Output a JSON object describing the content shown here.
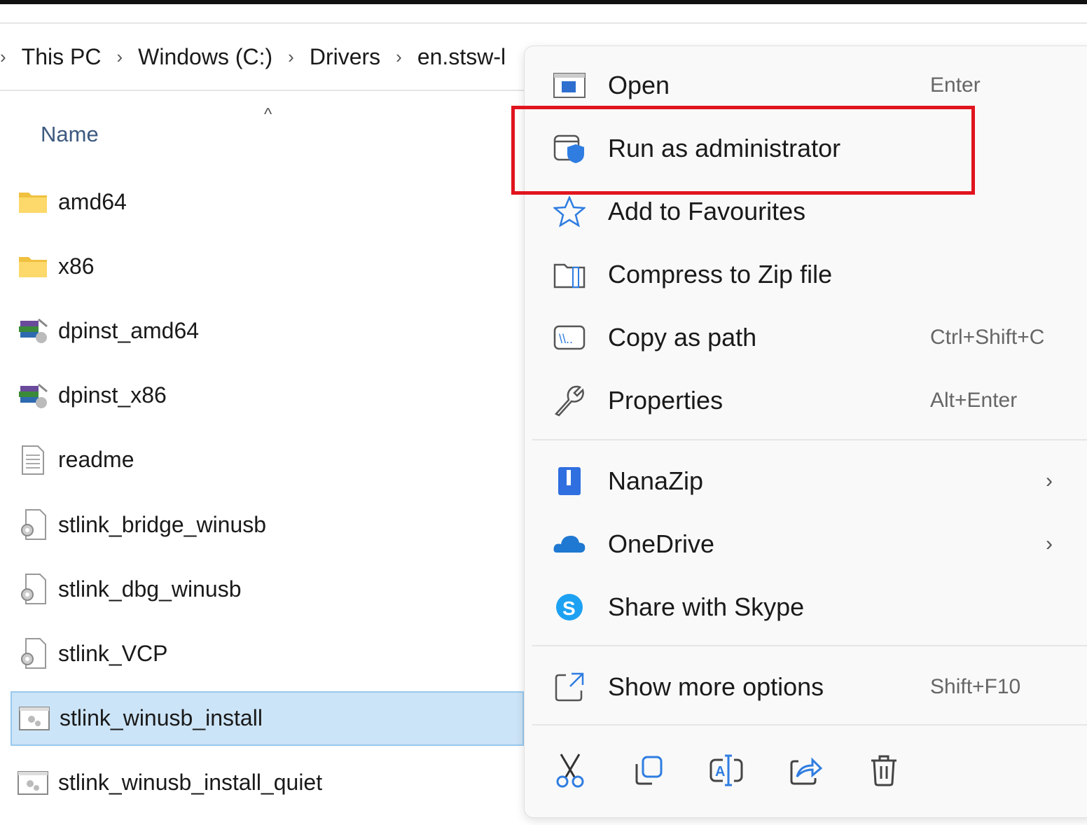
{
  "breadcrumb": [
    "This PC",
    "Windows (C:)",
    "Drivers",
    "en.stsw-l"
  ],
  "column_header": "Name",
  "files": [
    {
      "name": "amd64",
      "icon": "folder-icon"
    },
    {
      "name": "x86",
      "icon": "folder-icon"
    },
    {
      "name": "dpinst_amd64",
      "icon": "installer-icon"
    },
    {
      "name": "dpinst_x86",
      "icon": "installer-icon"
    },
    {
      "name": "readme",
      "icon": "text-file-icon"
    },
    {
      "name": "stlink_bridge_winusb",
      "icon": "settings-file-icon"
    },
    {
      "name": "stlink_dbg_winusb",
      "icon": "settings-file-icon"
    },
    {
      "name": "stlink_VCP",
      "icon": "settings-file-icon"
    },
    {
      "name": "stlink_winusb_install",
      "icon": "batch-file-icon",
      "selected": true
    },
    {
      "name": "stlink_winusb_install_quiet",
      "icon": "batch-file-icon"
    }
  ],
  "context_menu": {
    "items": [
      {
        "label": "Open",
        "shortcut": "Enter",
        "icon": "open-window-icon"
      },
      {
        "label": "Run as administrator",
        "shortcut": "",
        "icon": "shield-admin-icon",
        "highlighted": true
      },
      {
        "label": "Add to Favourites",
        "shortcut": "",
        "icon": "star-icon"
      },
      {
        "label": "Compress to Zip file",
        "shortcut": "",
        "icon": "zip-folder-icon"
      },
      {
        "label": "Copy as path",
        "shortcut": "Ctrl+Shift+C",
        "icon": "copy-path-icon"
      },
      {
        "label": "Properties",
        "shortcut": "Alt+Enter",
        "icon": "wrench-icon"
      },
      {
        "label": "NanaZip",
        "shortcut": "",
        "icon": "nanazip-icon",
        "submenu": true
      },
      {
        "label": "OneDrive",
        "shortcut": "",
        "icon": "onedrive-cloud-icon",
        "submenu": true
      },
      {
        "label": "Share with Skype",
        "shortcut": "",
        "icon": "skype-icon"
      },
      {
        "label": "Show more options",
        "shortcut": "Shift+F10",
        "icon": "more-options-icon"
      }
    ],
    "quick_actions": [
      "cut",
      "copy",
      "rename",
      "share",
      "delete"
    ]
  },
  "colors": {
    "highlight_box": "#e0141e",
    "selection": "#cce4f7",
    "accent": "#2f7de1"
  }
}
